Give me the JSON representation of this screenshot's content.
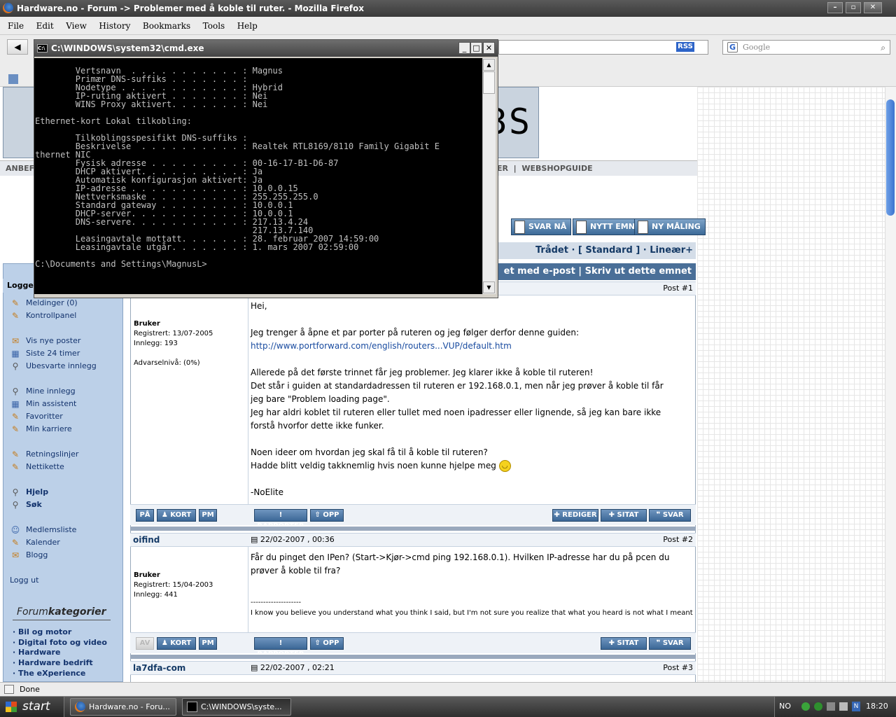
{
  "firefox": {
    "window_title": "Hardware.no - Forum -> Problemer med å koble til ruter. - Mozilla Firefox",
    "menu": [
      "File",
      "Edit",
      "View",
      "History",
      "Bookmarks",
      "Tools",
      "Help"
    ],
    "search_placeholder": "Google",
    "rss_label": "RSS",
    "status": "Done"
  },
  "forum": {
    "logo_text": "3S",
    "nav_left": "ANBEFA",
    "nav_right_prefix": "ER",
    "nav_right_sep": "|",
    "nav_right_item": "WEBSHOPGUIDE",
    "buttons": {
      "reply": "SVAR NÅ",
      "new_topic": "NYTT EMNE",
      "new_poll": "NY MÅLING"
    },
    "view_modes": "Trådet · [ Standard ] · Lineær+",
    "tools_line": "et med e-post | Skriv ut dette emnet",
    "sidebar": {
      "heading": "Logge",
      "links": [
        {
          "label": "Meldinger (0)",
          "icon": "folder-icon"
        },
        {
          "label": "Kontrollpanel",
          "icon": "folder-icon"
        },
        {
          "label": "Vis nye poster",
          "icon": "envelope-icon"
        },
        {
          "label": "Siste 24 timer",
          "icon": "calendar-icon"
        },
        {
          "label": "Ubesvarte innlegg",
          "icon": "search-icon"
        },
        {
          "label": "Mine innlegg",
          "icon": "search-icon"
        },
        {
          "label": "Min assistent",
          "icon": "calendar-icon"
        },
        {
          "label": "Favoritter",
          "icon": "folder-icon"
        },
        {
          "label": "Min karriere",
          "icon": "folder-icon"
        },
        {
          "label": "Retningslinjer",
          "icon": "folder-icon"
        },
        {
          "label": "Nettikette",
          "icon": "folder-icon"
        },
        {
          "label": "Hjelp",
          "icon": "search-icon"
        },
        {
          "label": "Søk",
          "icon": "search-icon"
        },
        {
          "label": "Medlemsliste",
          "icon": "people-icon"
        },
        {
          "label": "Kalender",
          "icon": "folder-icon"
        },
        {
          "label": "Blogg",
          "icon": "envelope-icon"
        },
        {
          "label": "Logg ut",
          "icon": ""
        }
      ],
      "categories_title_a": "Forum",
      "categories_title_b": "kategorier",
      "categories": [
        "Bil og motor",
        "Digital foto og video",
        "Hardware",
        "Hardware bedrift",
        "The eXperience"
      ]
    },
    "posts": [
      {
        "number": "Post #1",
        "role": "Bruker",
        "registered": "Registrert: 13/07-2005",
        "posts_count": "Innlegg: 193",
        "warning": "Advarselnivå: (0%)",
        "body": [
          "Hei,",
          "",
          "Jeg trenger å åpne et par porter på ruteren og jeg følger derfor denne guiden:",
          "http://www.portforward.com/english/routers...VUP/default.htm",
          "",
          "Allerede på det første trinnet får jeg problemer. Jeg klarer ikke å koble til ruteren!",
          "Det står i guiden at standardadressen til ruteren er 192.168.0.1, men når jeg prøver å koble til får",
          "jeg bare \"Problem loading page\".",
          "Jeg har aldri koblet til ruteren eller tullet med noen ipadresser eller lignende, så jeg kan bare ikke",
          "forstå hvorfor dette ikke funker.",
          "",
          "Noen ideer om hvordan jeg skal få til å koble til ruteren?",
          "Hadde blitt veldig takknemlig hvis noen kunne hjelpe meg",
          "",
          "-NoElite"
        ],
        "left_buttons": [
          "PÅ",
          "KORT",
          "PM"
        ],
        "mid_buttons": [
          "RAPPORTER",
          "OPP"
        ],
        "right_buttons": [
          "REDIGER",
          "SITAT",
          "SVAR"
        ]
      },
      {
        "author": "oifind",
        "date": "22/02-2007 , 00:36",
        "number": "Post #2",
        "role": "Bruker",
        "registered": "Registrert: 15/04-2003",
        "posts_count": "Innlegg: 441",
        "body": [
          "Får du pinget den IPen? (Start->Kjør->cmd ping 192.168.0.1). Hvilken IP-adresse har du på pcen du",
          "prøver å koble til fra?"
        ],
        "signature_sep": "--------------------",
        "signature": "I know you believe you understand what you think I said, but I'm not sure you realize that what you heard is not what I meant",
        "left_buttons": [
          "AV",
          "KORT",
          "PM"
        ],
        "mid_buttons": [
          "RAPPORTER",
          "OPP"
        ],
        "right_buttons": [
          "SITAT",
          "SVAR"
        ]
      },
      {
        "author": "la7dfa-com",
        "date": "22/02-2007 , 02:21",
        "number": "Post #3"
      }
    ]
  },
  "cmd": {
    "title": "C:\\WINDOWS\\system32\\cmd.exe",
    "output": "        Vertsnavn  . . . . . . . . . . . : Magnus\n        Primær DNS-suffiks . . . . . . . :\n        Nodetype . . . . . . . . . . . . : Hybrid\n        IP-ruting aktivert . . . . . . . : Nei\n        WINS Proxy aktivert. . . . . . . : Nei\n\nEthernet-kort Lokal tilkobling:\n\n        Tilkoblingsspesifikt DNS-suffiks :\n        Beskrivelse  . . . . . . . . . . : Realtek RTL8169/8110 Family Gigabit E\nthernet NIC\n        Fysisk adresse . . . . . . . . . : 00-16-17-B1-D6-87\n        DHCP aktivert. . . . . . . . . . : Ja\n        Automatisk konfigurasjon aktivert: Ja\n        IP-adresse . . . . . . . . . . . : 10.0.0.15\n        Nettverksmaske . . . . . . . . . : 255.255.255.0\n        Standard gateway . . . . . . . . : 10.0.0.1\n        DHCP-server. . . . . . . . . . . : 10.0.0.1\n        DNS-servere. . . . . . . . . . . : 217.13.4.24\n                                           217.13.7.140\n        Leasingavtale mottatt. . . . . . : 28. februar 2007 14:59:00\n        Leasingavtale utgår. . . . . . . : 1. mars 2007 02:59:00\n\nC:\\Documents and Settings\\MagnusL>"
  },
  "taskbar": {
    "start": "start",
    "tasks": [
      "Hardware.no - Foru...",
      "C:\\WINDOWS\\syste..."
    ],
    "tray_lang": "NO",
    "clock": "18:20"
  }
}
